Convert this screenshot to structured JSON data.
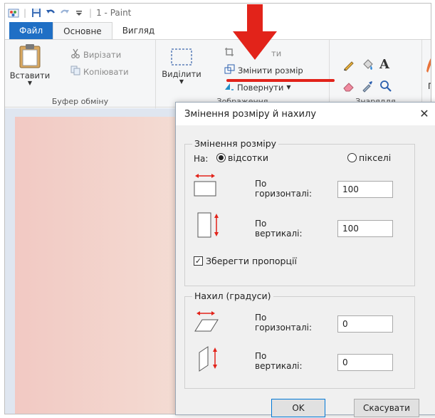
{
  "titlebar": {
    "title": "1 - Paint",
    "separator": "|"
  },
  "tabs": [
    {
      "label": "Файл"
    },
    {
      "label": "Основне"
    },
    {
      "label": "Вигляд"
    }
  ],
  "ribbon": {
    "clipboard": {
      "paste_label": "Вставити",
      "cut_label": "Вирізати",
      "copy_label": "Копіювати",
      "group_label": "Буфер обміну"
    },
    "image": {
      "select_label": "Виділити",
      "crop_label": "ти",
      "resize_label": "Змінити розмір",
      "rotate_label": "Повернути",
      "group_label": "Зображення"
    },
    "tools": {
      "group_label": "Знаряддя",
      "text_tool": "A"
    },
    "brushes_label": "Пе"
  },
  "colors": {
    "file_tab": "#1f6fc5",
    "annotation_red": "#e2231a"
  },
  "dialog": {
    "title": "Змінення розміру й нахилу",
    "close": "✕",
    "resize": {
      "title": "Змінення розміру",
      "by_label": "На:",
      "percent_label": "відсотки",
      "pixels_label": "пікселі",
      "selected": "percent",
      "horizontal_label_1": "По",
      "horizontal_label_2": "горизонталі:",
      "horizontal_value": "100",
      "vertical_label_1": "По",
      "vertical_label_2": "вертикалі:",
      "vertical_value": "100",
      "keep_ratio_label": "Зберегти пропорції",
      "keep_ratio_checked": true
    },
    "skew": {
      "title": "Нахил (градуси)",
      "horizontal_label_1": "По",
      "horizontal_label_2": "горизонталі:",
      "horizontal_value": "0",
      "vertical_label_1": "По",
      "vertical_label_2": "вертикалі:",
      "vertical_value": "0"
    },
    "ok_label": "OK",
    "cancel_label": "Скасувати"
  }
}
